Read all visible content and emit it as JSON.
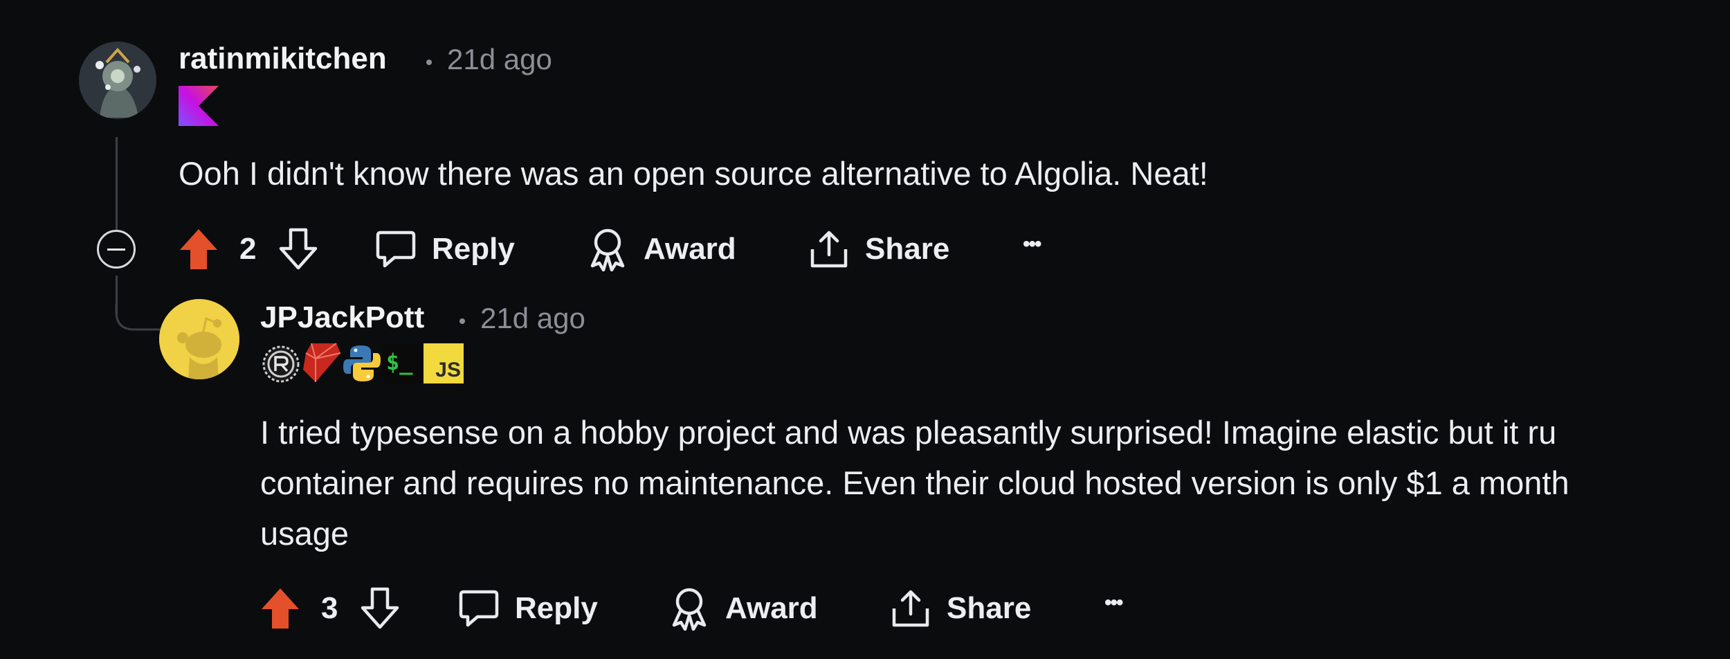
{
  "comments": [
    {
      "username": "ratinmikitchen",
      "timestamp": "21d ago",
      "text": "Ooh I didn't know there was an open source alternative to Algolia. Neat!",
      "flair_icons": [
        "kotlin-icon"
      ],
      "votes": "2",
      "actions": {
        "reply": "Reply",
        "award": "Award",
        "share": "Share",
        "more": "•••"
      }
    },
    {
      "username": "JPJackPott",
      "timestamp": "21d ago",
      "text_lines": [
        "I tried typesense on a hobby project and was pleasantly surprised! Imagine elastic but it ru",
        "container and requires no maintenance. Even their cloud hosted version is only $1 a month",
        "usage"
      ],
      "flair_icons": [
        "rust-icon",
        "ruby-icon",
        "python-icon",
        "terminal-icon",
        "javascript-icon"
      ],
      "flair_text": {
        "terminal": "$_",
        "javascript": "JS"
      },
      "votes": "3",
      "actions": {
        "reply": "Reply",
        "award": "Award",
        "share": "Share",
        "more": "•••"
      }
    }
  ],
  "colors": {
    "background": "#0b0c0e",
    "upvote": "#e4502a",
    "timestamp": "#8b8f96",
    "text": "#eceef1",
    "snoo_avatar_bg": "#f1d145"
  }
}
